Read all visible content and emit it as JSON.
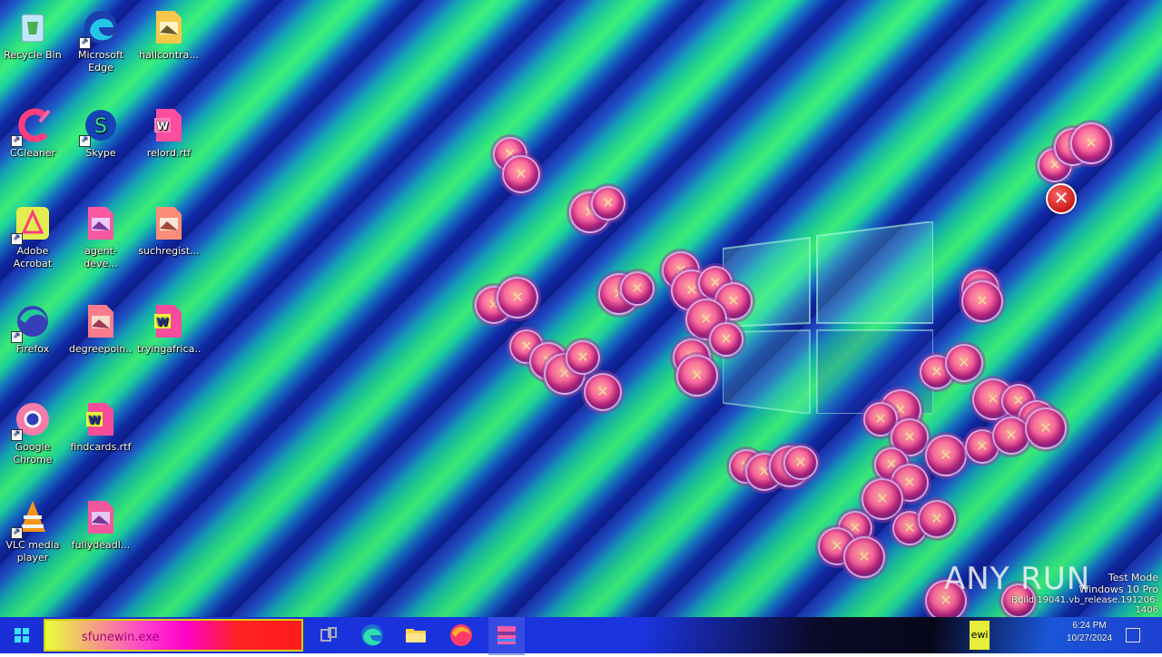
{
  "desktop_icons": [
    {
      "label": "Recycle Bin",
      "icon": "recycle-bin-icon"
    },
    {
      "label": "Microsoft Edge",
      "icon": "edge-icon"
    },
    {
      "label": "hallcontra...",
      "icon": "image-file-icon"
    },
    {
      "label": "CCleaner",
      "icon": "ccleaner-icon"
    },
    {
      "label": "Skype",
      "icon": "skype-icon"
    },
    {
      "label": "relord.rtf",
      "icon": "word-doc-icon"
    },
    {
      "label": "Adobe Acrobat",
      "icon": "acrobat-icon"
    },
    {
      "label": "agent-deve...",
      "icon": "image-file-icon"
    },
    {
      "label": "suchregist...",
      "icon": "image-file-icon"
    },
    {
      "label": "Firefox",
      "icon": "firefox-icon"
    },
    {
      "label": "degreepoin...",
      "icon": "image-file-icon"
    },
    {
      "label": "tryingafrica...",
      "icon": "word-doc-icon"
    },
    {
      "label": "Google Chrome",
      "icon": "chrome-icon"
    },
    {
      "label": "findcards.rtf",
      "icon": "word-doc-icon"
    },
    {
      "label": "VLC media player",
      "icon": "vlc-icon"
    },
    {
      "label": "fullydeadl...",
      "icon": "image-file-icon"
    }
  ],
  "taskbar": {
    "search_value": "sfunewin.exe",
    "pinned": [
      {
        "name": "task-view",
        "icon": "task-view-icon"
      },
      {
        "name": "edge",
        "icon": "edge-icon"
      },
      {
        "name": "file-explorer",
        "icon": "folder-icon"
      },
      {
        "name": "firefox",
        "icon": "firefox-icon"
      },
      {
        "name": "winrar",
        "icon": "winrar-icon"
      }
    ],
    "tray_fragment": "ewi",
    "clock_time": "6:24 PM",
    "clock_date": "10/27/2024"
  },
  "watermark": {
    "line1": "Test Mode",
    "line2": "Windows 10 Pro",
    "line3": "Build 19041.vb_release.191206-1406",
    "brand": "ANY RUN"
  },
  "error_dialog_icon": "error-x-icon",
  "colors": {
    "accent": "#22d38e",
    "error": "#d01818",
    "taskbar": "#1b34e0"
  }
}
